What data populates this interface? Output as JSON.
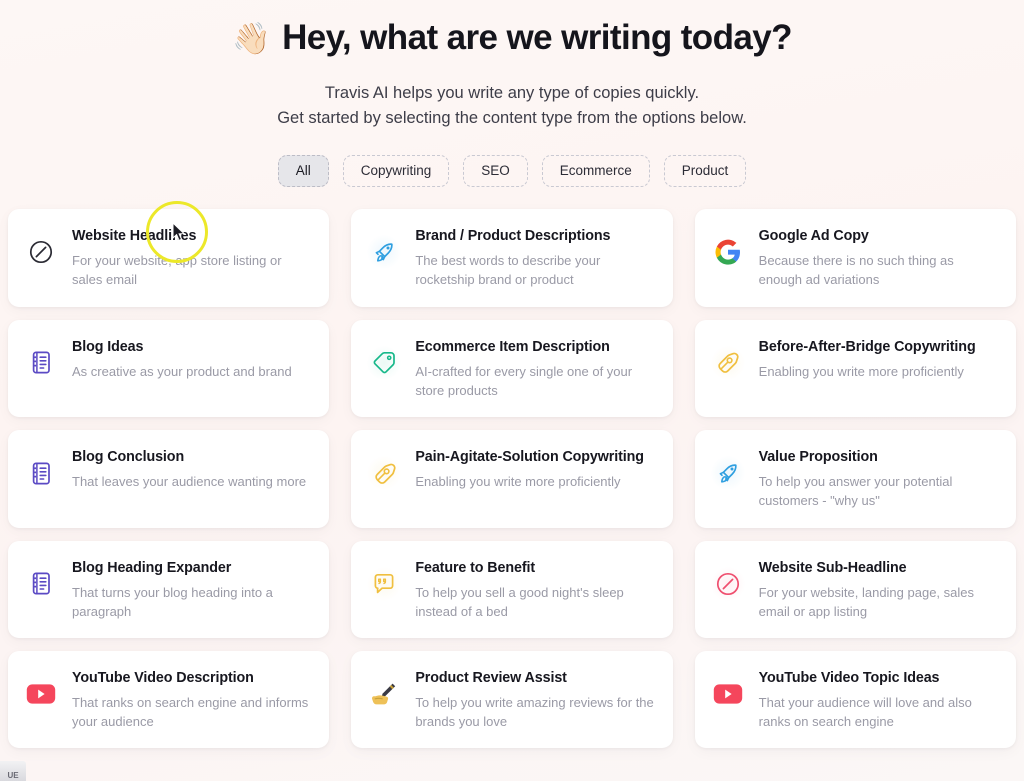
{
  "hero": {
    "emoji": "👋🏻",
    "emoji_name": "waving-hand",
    "title": "Hey, what are we writing today?",
    "subtitle_line1": "Travis AI helps you write any type of copies quickly.",
    "subtitle_line2": "Get started by selecting the content type from the options below."
  },
  "filters": {
    "items": [
      {
        "label": "All",
        "active": true
      },
      {
        "label": "Copywriting",
        "active": false
      },
      {
        "label": "SEO",
        "active": false
      },
      {
        "label": "Ecommerce",
        "active": false
      },
      {
        "label": "Product",
        "active": false
      }
    ]
  },
  "cards": [
    {
      "title": "Website Headlines",
      "desc": "For your website, app store listing or sales email",
      "icon": "circle-slash-dark-icon",
      "color": "#2a2a33"
    },
    {
      "title": "Brand / Product Descriptions",
      "desc": "The best words to describe your rocketship brand or product",
      "icon": "rocket-icon",
      "color": "#2f9fe0"
    },
    {
      "title": "Google Ad Copy",
      "desc": "Because there is no such thing as enough ad variations",
      "icon": "google-g-icon",
      "color": "#4285f4"
    },
    {
      "title": "Blog Ideas",
      "desc": "As creative as your product and brand",
      "icon": "document-list-icon",
      "color": "#5b4ac4"
    },
    {
      "title": "Ecommerce Item Description",
      "desc": "AI-crafted for every single one of your store products",
      "icon": "price-tag-icon",
      "color": "#17b88a"
    },
    {
      "title": "Before-After-Bridge Copywriting",
      "desc": "Enabling you write more proficiently",
      "icon": "pen-nib-icon",
      "color": "#f0bf3f"
    },
    {
      "title": "Blog Conclusion",
      "desc": "That leaves your audience wanting more",
      "icon": "document-list-icon",
      "color": "#5b4ac4"
    },
    {
      "title": "Pain-Agitate-Solution Copywriting",
      "desc": "Enabling you write more proficiently",
      "icon": "pen-nib-icon",
      "color": "#f0bf3f"
    },
    {
      "title": "Value Proposition",
      "desc": "To help you answer your potential customers - \"why us\"",
      "icon": "rocket-icon",
      "color": "#2f9fe0"
    },
    {
      "title": "Blog Heading Expander",
      "desc": "That turns your blog heading into a paragraph",
      "icon": "document-list-icon",
      "color": "#5b4ac4"
    },
    {
      "title": "Feature to Benefit",
      "desc": "To help you sell a good night's sleep instead of a bed",
      "icon": "quote-bubble-icon",
      "color": "#f0bf3f"
    },
    {
      "title": "Website Sub-Headline",
      "desc": "For your website, landing page, sales email or app listing",
      "icon": "circle-slash-pink-icon",
      "color": "#ef4e6e"
    },
    {
      "title": "YouTube Video Description",
      "desc": "That ranks on search engine and informs your audience",
      "icon": "youtube-icon",
      "color": "#f5465c"
    },
    {
      "title": "Product Review Assist",
      "desc": "To help you write amazing reviews for the brands you love",
      "icon": "writing-hand-icon",
      "color": "#e8b84b"
    },
    {
      "title": "YouTube Video Topic Ideas",
      "desc": "That your audience will love and also ranks on search engine",
      "icon": "youtube-icon",
      "color": "#f5465c"
    }
  ],
  "cursor": {
    "highlight_color": "#ece829"
  },
  "corner_badge": {
    "label": "UE"
  }
}
